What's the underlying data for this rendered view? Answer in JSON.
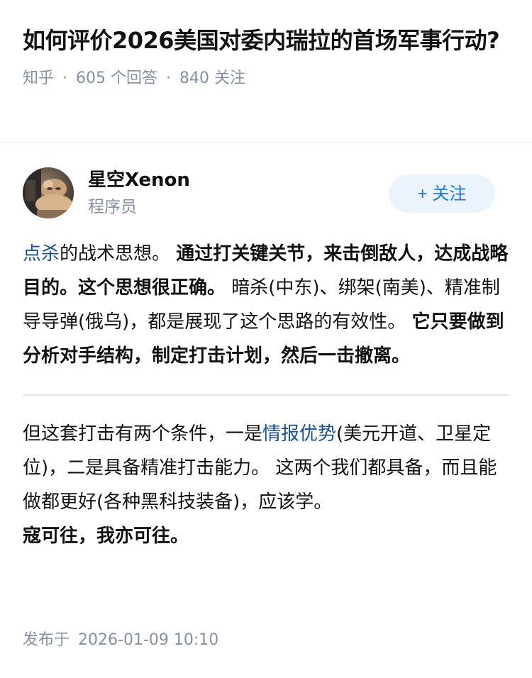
{
  "question": {
    "title": "如何评价2026美国对委内瑞拉的首场军事行动?",
    "source": "知乎",
    "answers_count": "605",
    "answers_label": "个回答",
    "followers_count": "840",
    "followers_label": "关注"
  },
  "author": {
    "name": "星空Xenon",
    "headline": "程序员",
    "follow_label": "+ 关注"
  },
  "answer": {
    "p1": {
      "link1": "点杀",
      "t1": "的战术思想。",
      "b1": "通过打关键关节，来击倒敌人，达成战略目的。这个思想很正确。",
      "t2": "暗杀(中东)、绑架(南美)、精准制导导弹(俄乌)，都是展现了这个思路的有效性。",
      "b2": "它只要做到分析对手结构，制定打击计划，然后一击撤离。"
    },
    "p2": {
      "t1": "但这套打击有两个条件，一是",
      "link1": "情报优势",
      "t2": "(美元开道、卫星定位)，二是具备精准打击能力。 这两个我们都具备，而且能做都更好(各种黑科技装备)，应该学。",
      "b1": "寇可往，我亦可往。"
    }
  },
  "publish": {
    "label": "发布于",
    "time": "2026-01-09 10:10"
  },
  "icons": {
    "avatar": "avatar-image"
  }
}
